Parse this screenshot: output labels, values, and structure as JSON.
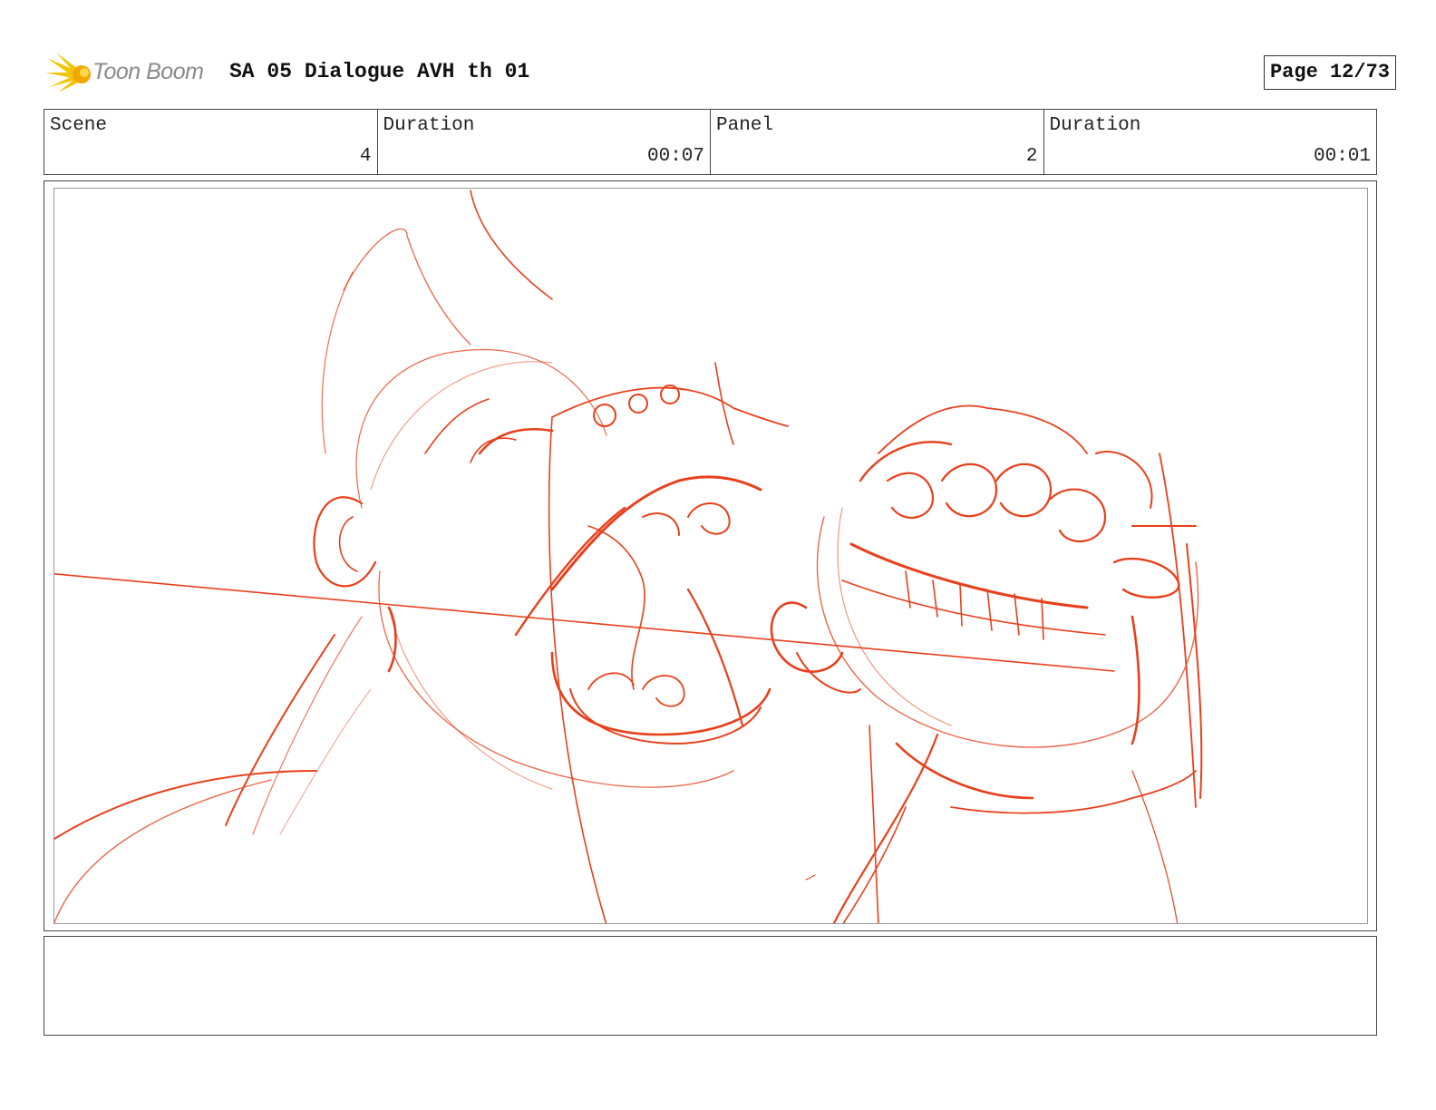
{
  "header": {
    "logo_text": "Toon Boom",
    "title": "SA 05 Dialogue AVH th 01",
    "page": "Page 12/73"
  },
  "info": {
    "scene_label": "Scene",
    "scene_value": "4",
    "scene_duration_label": "Duration",
    "scene_duration_value": "00:07",
    "panel_label": "Panel",
    "panel_value": "2",
    "panel_duration_label": "Duration",
    "panel_duration_value": "00:01"
  },
  "colors": {
    "sketch": "#e8401c",
    "logo_accent": "#f5c400"
  },
  "notes": {
    "text": ""
  }
}
